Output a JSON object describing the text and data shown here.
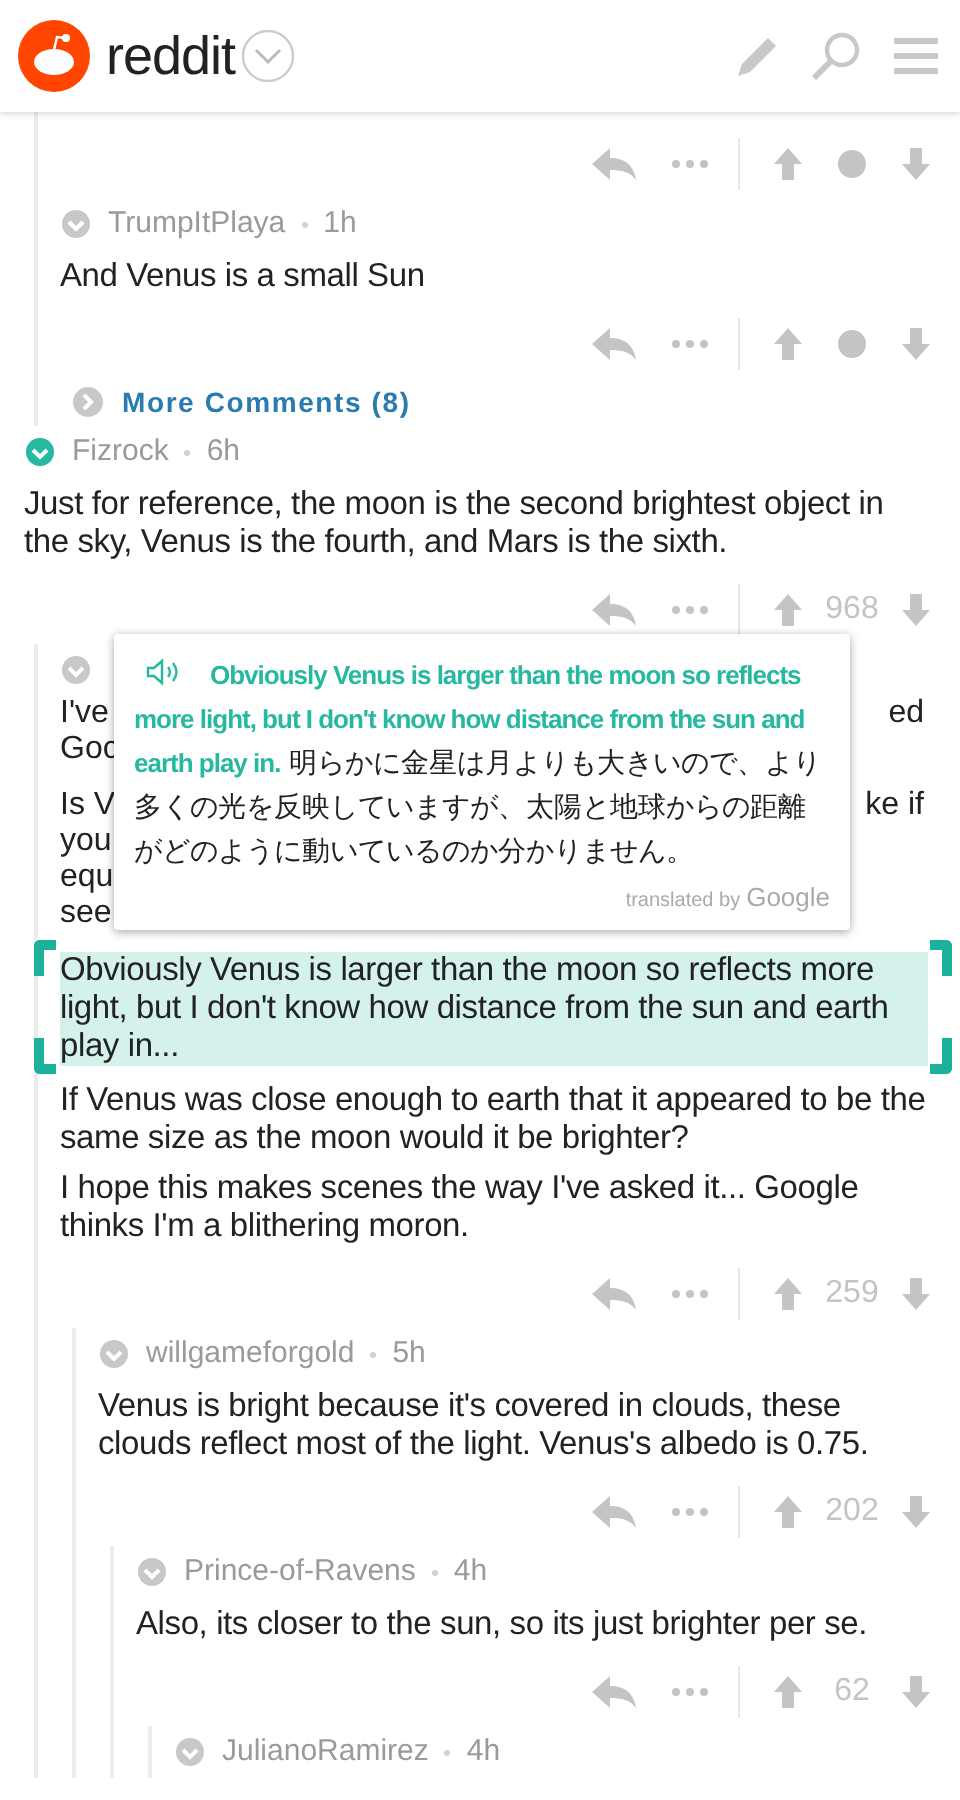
{
  "header": {
    "logo_text": "reddit"
  },
  "earlier_replies": [
    {
      "kind": "actions"
    },
    {
      "kind": "comment",
      "author": "TrumpItPlaya",
      "time": "1h",
      "color": "#c8c8c8",
      "paragraphs": [
        "And Venus is a small Sun"
      ]
    },
    {
      "kind": "more",
      "label": "More Comments (8)"
    }
  ],
  "comments": [
    {
      "author": "Fizrock",
      "time": "6h",
      "color": "#26b8a0",
      "paragraphs": [
        "Just for reference, the moon is the second brightest object in the sky, Venus is the fourth, and Mars is the sixth."
      ],
      "score": "968",
      "children": [
        {
          "kind": "covered",
          "color": "#c8c8c8",
          "fragments": [
            [
              {
                "left": "I've",
                "right": "ed"
              },
              {
                "left": "Goc"
              }
            ],
            [
              {
                "left": "Is V",
                "right": "ke if"
              },
              {
                "left": "you"
              },
              {
                "left": "equ"
              },
              {
                "left": "see"
              }
            ]
          ],
          "selection": "Obviously Venus is larger than the moon so reflects more light, but I don't know how distance from the sun and earth play in...",
          "paragraphs": [
            "If Venus was close enough to earth that it appeared to be the same size as the moon would it be brighter?",
            "I hope this makes scenes the way I've asked it... Google thinks I'm a blithering moron."
          ],
          "score": "259",
          "children": [
            {
              "author": "willgameforgold",
              "time": "5h",
              "color": "#c8c8c8",
              "paragraphs": [
                "Venus is bright because it's covered in clouds, these clouds reflect most of the light. Venus's albedo is 0.75."
              ],
              "score": "202",
              "children": [
                {
                  "author": "Prince-of-Ravens",
                  "time": "4h",
                  "color": "#c8c8c8",
                  "paragraphs": [
                    "Also, its closer to the sun, so its just brighter per se."
                  ],
                  "score": "62",
                  "children": [
                    {
                      "author": "JulianoRamirez",
                      "time": "4h",
                      "color": "#c8c8c8"
                    }
                  ]
                }
              ]
            }
          ]
        }
      ]
    }
  ],
  "translation_popup": {
    "source": "Obviously Venus is larger than the moon so reflects more light, but I don't know how distance from the sun and earth play in.",
    "translation": "明らかに金星は月よりも大きいので、より多くの光を反映していますが、太陽と地球からの距離がどのように動いているのか分かりません。",
    "credit_prefix": "translated by",
    "credit_brand": "Google"
  }
}
